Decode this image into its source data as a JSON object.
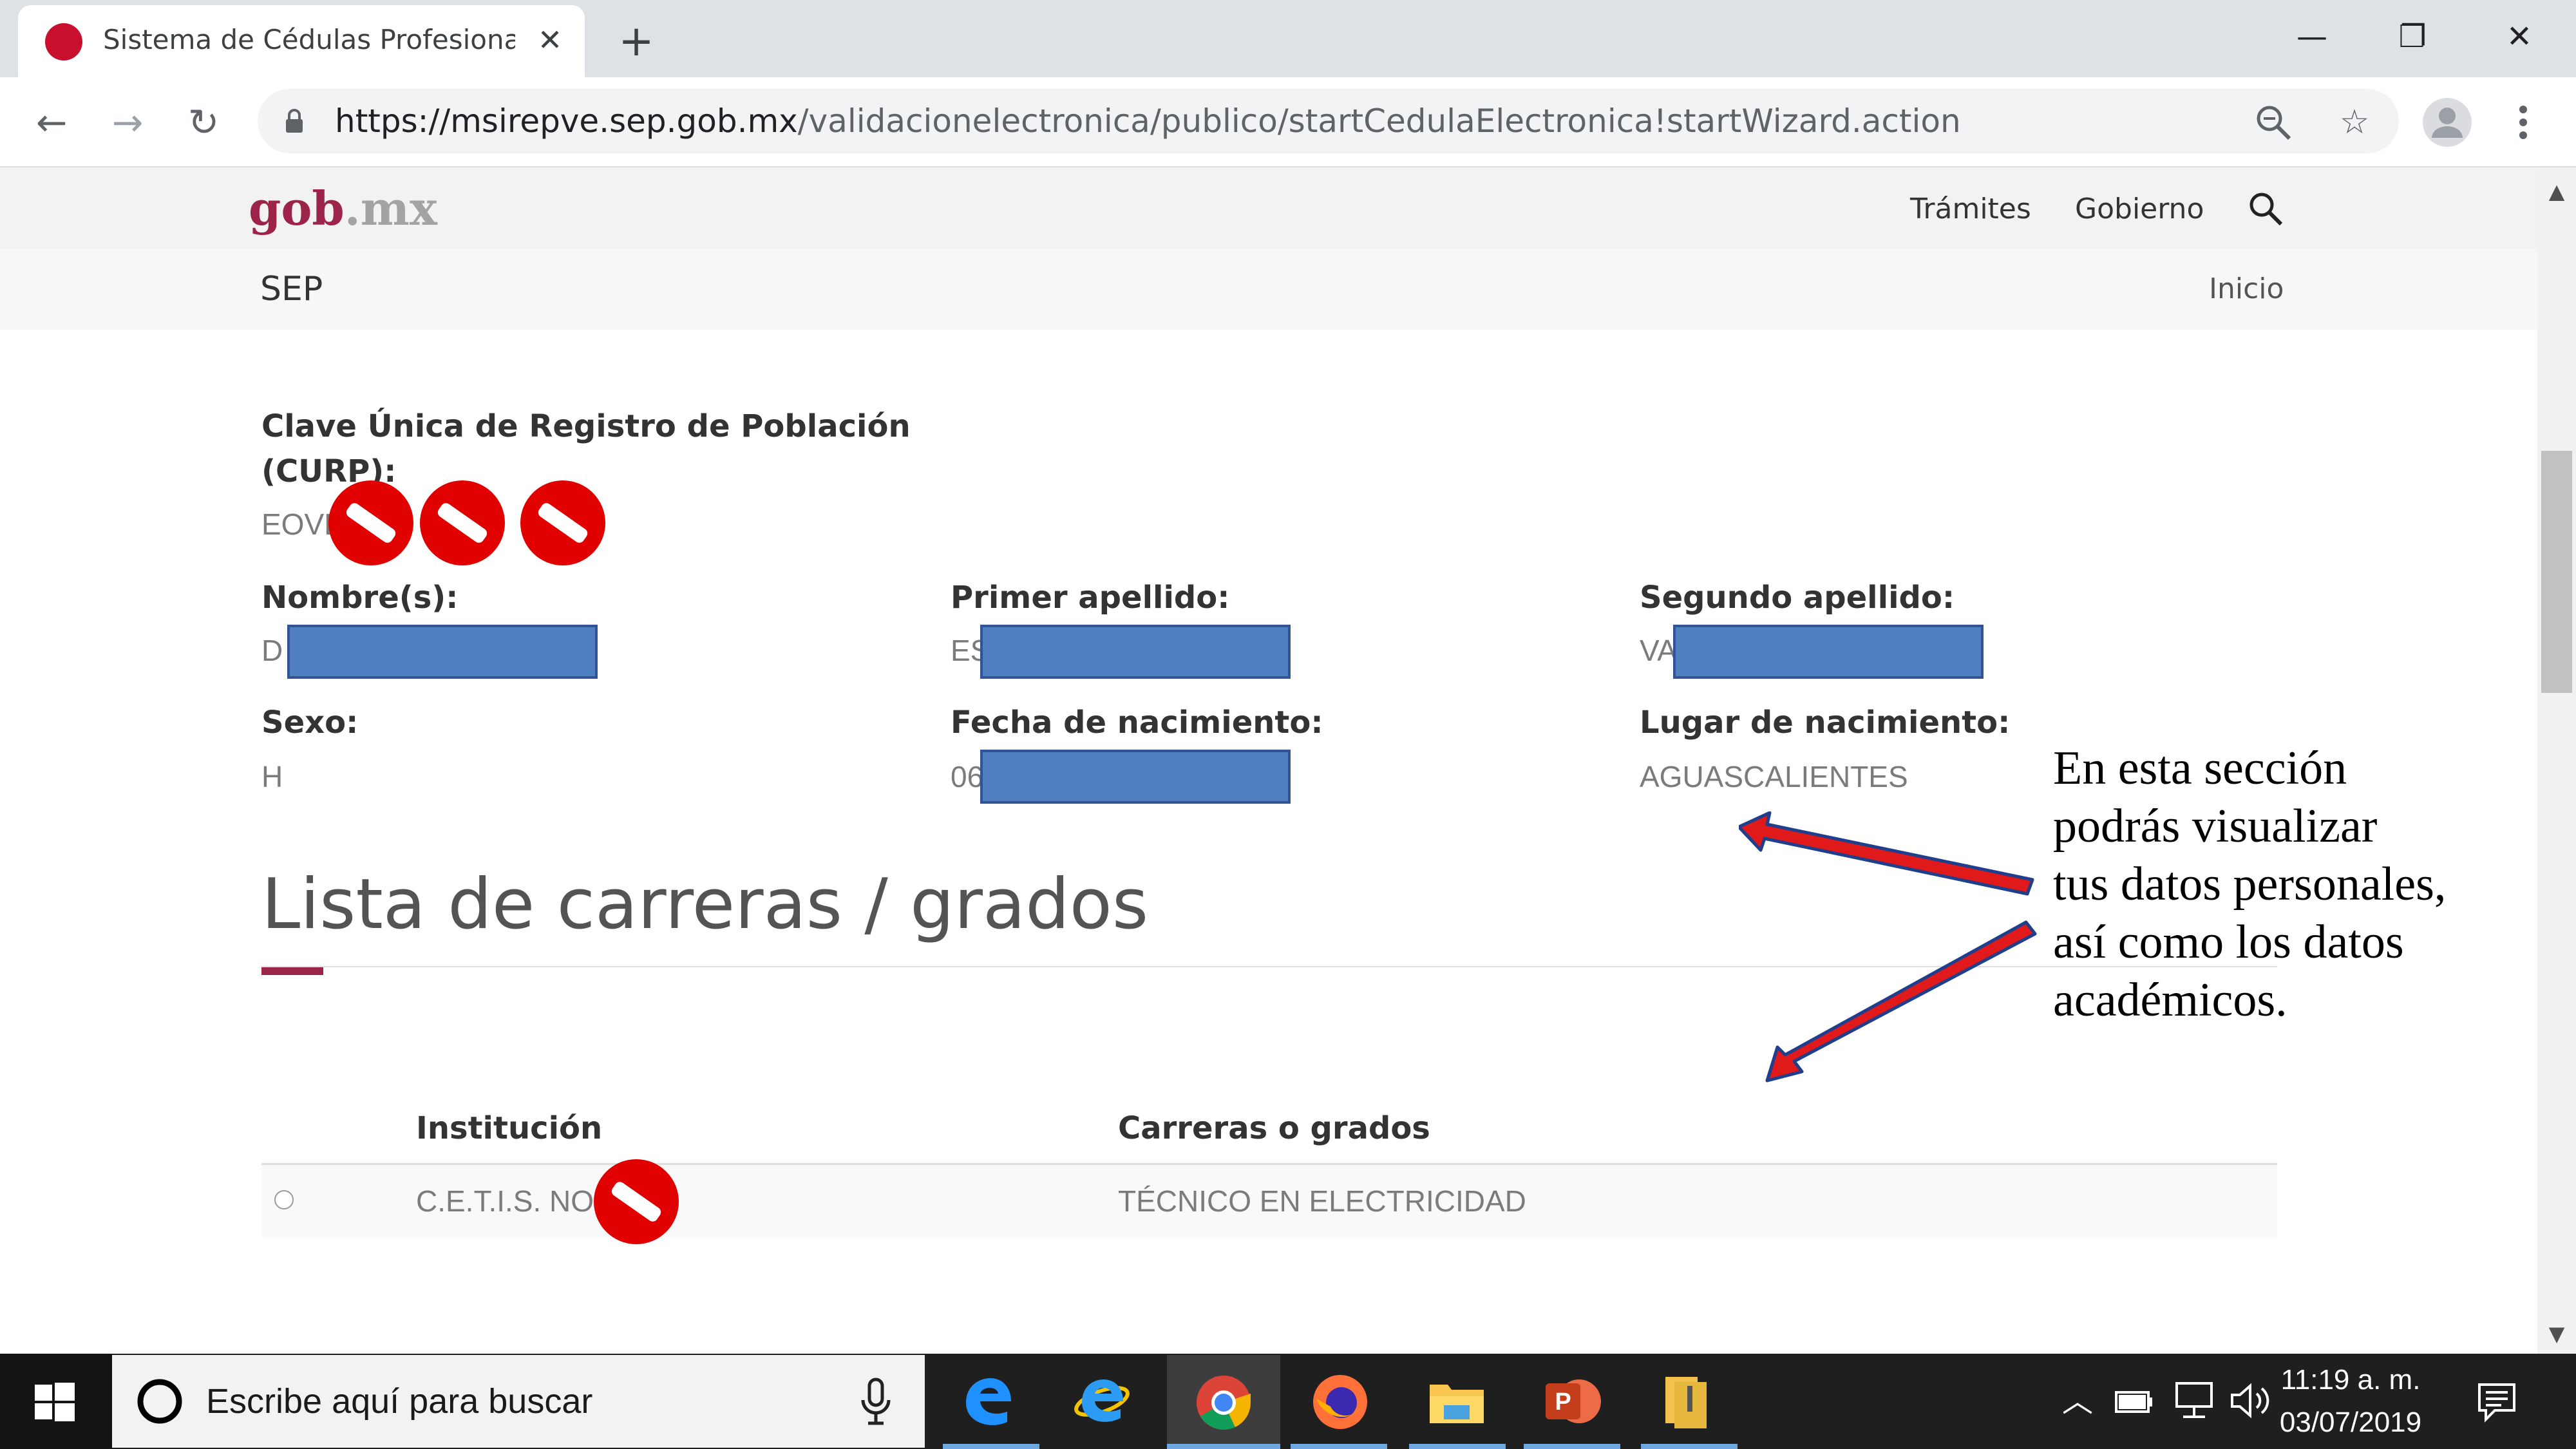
{
  "browser": {
    "tab_title": "Sistema de Cédulas Profesionales",
    "tab_close": "✕",
    "new_tab": "+",
    "url_host": "https://msirepve.sep.gob.mx",
    "url_path": "/validacionelectronica/publico/startCedulaElectronica!startWizard.action",
    "window_controls": {
      "minimize": "—",
      "restore": "❐",
      "close": "✕"
    },
    "nav": {
      "back": "←",
      "forward": "→",
      "reload": "↻"
    },
    "zoom_icon": "zoom-icon",
    "bookmark_icon": "☆"
  },
  "header": {
    "logo_main": "gob",
    "logo_dot": ".mx",
    "nav_tramites": "Trámites",
    "nav_gobierno": "Gobierno",
    "sub_title": "SEP",
    "sub_link": "Inicio"
  },
  "form": {
    "curp_label_line1": "Clave Única de Registro de Población",
    "curp_label_line2": "(CURP):",
    "curp_value": "EOVD",
    "nombre_label": "Nombre(s):",
    "nombre_value": "D",
    "primer_apellido_label": "Primer apellido:",
    "primer_apellido_value": "ES",
    "segundo_apellido_label": "Segundo apellido:",
    "segundo_apellido_value": "VA",
    "sexo_label": "Sexo:",
    "sexo_value": "H",
    "fecha_label": "Fecha de nacimiento:",
    "fecha_value": "06",
    "lugar_label": "Lugar de nacimiento:",
    "lugar_value": "AGUASCALIENTES"
  },
  "careers": {
    "title": "Lista de carreras / grados",
    "col_institucion": "Institución",
    "col_carreras": "Carreras o grados",
    "rows": [
      {
        "institucion": "C.E.T.I.S. NO.",
        "carrera": "TÉCNICO EN ELECTRICIDAD"
      }
    ]
  },
  "annotation": {
    "line1": "En esta sección",
    "line2": "podrás visualizar",
    "line3": "tus datos personales,",
    "line4": "así como los datos",
    "line5": "académicos."
  },
  "taskbar": {
    "search_placeholder": "Escribe aquí para buscar",
    "time": "11:19 a. m.",
    "date": "03/07/2019",
    "apps": [
      "edge-icon",
      "internet-explorer-icon",
      "chrome-icon",
      "firefox-icon",
      "file-explorer-icon",
      "powerpoint-icon",
      "archive-icon"
    ]
  },
  "colors": {
    "brand": "#9d2449",
    "redaction_bar": "#4f7fc1",
    "redaction_stamp": "#e00000",
    "arrow_fill": "#e01a1a",
    "arrow_outline": "#1f3e8c"
  }
}
